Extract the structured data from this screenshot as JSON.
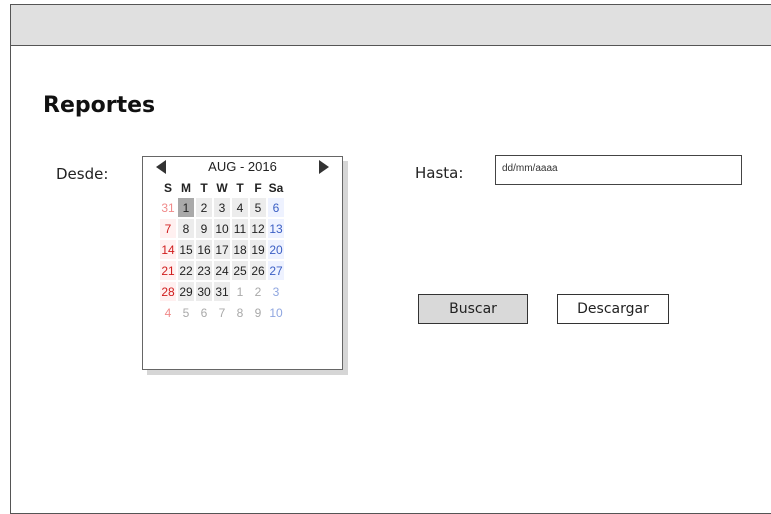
{
  "page": {
    "title": "Reportes"
  },
  "filters": {
    "from_label": "Desde:",
    "to_label": "Hasta:",
    "to_placeholder": "dd/mm/aaaa"
  },
  "calendar": {
    "month_label": "AUG - 2016",
    "weekdays": [
      "S",
      "M",
      "T",
      "W",
      "T",
      "F",
      "Sa"
    ],
    "weeks": [
      [
        "31",
        "1",
        "2",
        "3",
        "4",
        "5",
        "6"
      ],
      [
        "7",
        "8",
        "9",
        "10",
        "11",
        "12",
        "13"
      ],
      [
        "14",
        "15",
        "16",
        "17",
        "18",
        "19",
        "20"
      ],
      [
        "21",
        "22",
        "23",
        "24",
        "25",
        "26",
        "27"
      ],
      [
        "28",
        "29",
        "30",
        "31",
        "1",
        "2",
        "3"
      ],
      [
        "4",
        "5",
        "6",
        "7",
        "8",
        "9",
        "10"
      ]
    ],
    "selected": "1",
    "prev_icon": "triangle-left-icon",
    "next_icon": "triangle-right-icon"
  },
  "actions": {
    "search_label": "Buscar",
    "download_label": "Descargar"
  }
}
